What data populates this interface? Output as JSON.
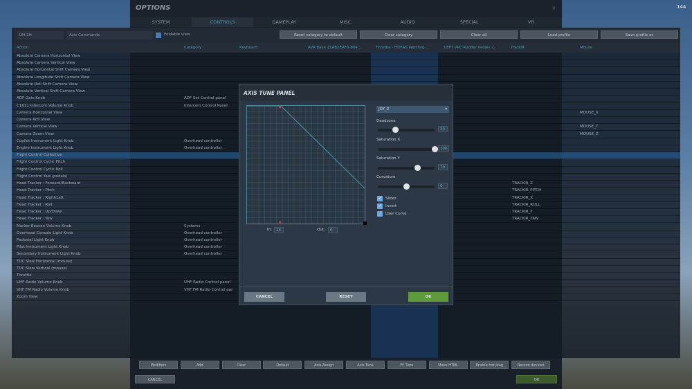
{
  "window": {
    "title": "OPTIONS",
    "close": "x",
    "fps": "144"
  },
  "tabs": [
    "SYSTEM",
    "CONTROLS",
    "GAMEPLAY",
    "MISC.",
    "AUDIO",
    "SPECIAL",
    "VR"
  ],
  "toolbar": {
    "aircraft": "UH-1H",
    "category": "Axis Commands",
    "foldable": "Foldable view",
    "buttons": [
      "Reset category to default",
      "Clear category",
      "Clear all",
      "Load profile",
      "Save profile as"
    ]
  },
  "columns": [
    "Action",
    "Category",
    "Keyboard",
    "AVA Base {1AB2EAF0-804...",
    "Throttle - HOTAS Warthog ...",
    "LEFT VPC Rudder Pedals {...",
    "TrackIR",
    "Mouse"
  ],
  "rows": [
    {
      "action": "Absolute Camera Horizontal View"
    },
    {
      "action": "Absolute Camera Vertical View"
    },
    {
      "action": "Absolute Horizontal Shift Camera View"
    },
    {
      "action": "Absolute Longitude Shift Camera View"
    },
    {
      "action": "Absolute Roll Shift Camera View"
    },
    {
      "action": "Absolute Vertical Shift Camera View"
    },
    {
      "action": "ADF Gain Knob",
      "category": "ADF Set Control panel"
    },
    {
      "action": "C1611 Intercom Volume Knob",
      "category": "Intercom Control Panel"
    },
    {
      "action": "Camera Horizontal View",
      "mouse": "MOUSE_X"
    },
    {
      "action": "Camera Roll View"
    },
    {
      "action": "Camera Vertical View",
      "mouse": "MOUSE_Y"
    },
    {
      "action": "Camera Zoom View",
      "mouse": "MOUSE_Z"
    },
    {
      "action": "Copilot Instrument Light Knob",
      "category": "Overhead controller"
    },
    {
      "action": "Engine Instrument Light Knob",
      "category": "Overhead controller"
    },
    {
      "action": "Flight Control Collective",
      "selected": true
    },
    {
      "action": "Flight Control Cyclic Pitch"
    },
    {
      "action": "Flight Control Cyclic Roll"
    },
    {
      "action": "Flight Control Yaw (pedals)"
    },
    {
      "action": "Head Tracker : Forward/Backward",
      "trackir": "TRACKIR_Z"
    },
    {
      "action": "Head Tracker : Pitch",
      "trackir": "TRACKIR_PITCH"
    },
    {
      "action": "Head Tracker : Right/Left",
      "trackir": "TRACKIR_X"
    },
    {
      "action": "Head Tracker : Roll",
      "trackir": "TRACKIR_ROLL"
    },
    {
      "action": "Head Tracker : Up/Down",
      "trackir": "TRACKIR_Y"
    },
    {
      "action": "Head Tracker : Yaw",
      "trackir": "TRACKIR_YAW"
    },
    {
      "action": "Marker Beacon Volume Knob",
      "category": "Systems"
    },
    {
      "action": "Overhead Console Light Knob",
      "category": "Overhead controller"
    },
    {
      "action": "Pedestal Light Knob",
      "category": "Overhead controller"
    },
    {
      "action": "Pilot Instrument Light Knob",
      "category": "Overhead controller"
    },
    {
      "action": "Secondary Instrument Light Knob",
      "category": "Overhead controller"
    },
    {
      "action": "TDC Slew Horizontal (mouse)"
    },
    {
      "action": "TDC Slew Vertical (mouse)"
    },
    {
      "action": "Throttle"
    },
    {
      "action": "UHF Radio Volume Knob",
      "category": "UHF Radio Control panel"
    },
    {
      "action": "VHF FM Radio Volume Knob",
      "category": "VHF FM Radio Control par"
    },
    {
      "action": "Zoom View"
    }
  ],
  "bottom_buttons": [
    "Modifiers",
    "Add",
    "Clear",
    "Default",
    "Axis Assign",
    "Axis Tune",
    "FF Tune",
    "Make HTML",
    "Enable hot plug",
    "Rescan devices"
  ],
  "footer": {
    "cancel": "CANCEL",
    "ok": "OK"
  },
  "axis_tune": {
    "title": "AXIS TUNE PANEL",
    "axis": "JOY_Z",
    "deadzone_label": "Deadzone",
    "deadzone": 30,
    "satx_label": "Saturation X",
    "saturation_x": 100,
    "saty_label": "Saturation Y",
    "saturation_y": 70,
    "curv_label": "Curvature",
    "curvature": 0,
    "slider_label": "Slider",
    "slider": true,
    "invert_label": "Invert",
    "invert": true,
    "user_curve_label": "User Curve",
    "user_curve": false,
    "in_label": "In:",
    "in": "28",
    "out_label": "Out:",
    "out": "0",
    "cancel": "CANCEL",
    "reset": "RESET",
    "ok": "OK"
  }
}
